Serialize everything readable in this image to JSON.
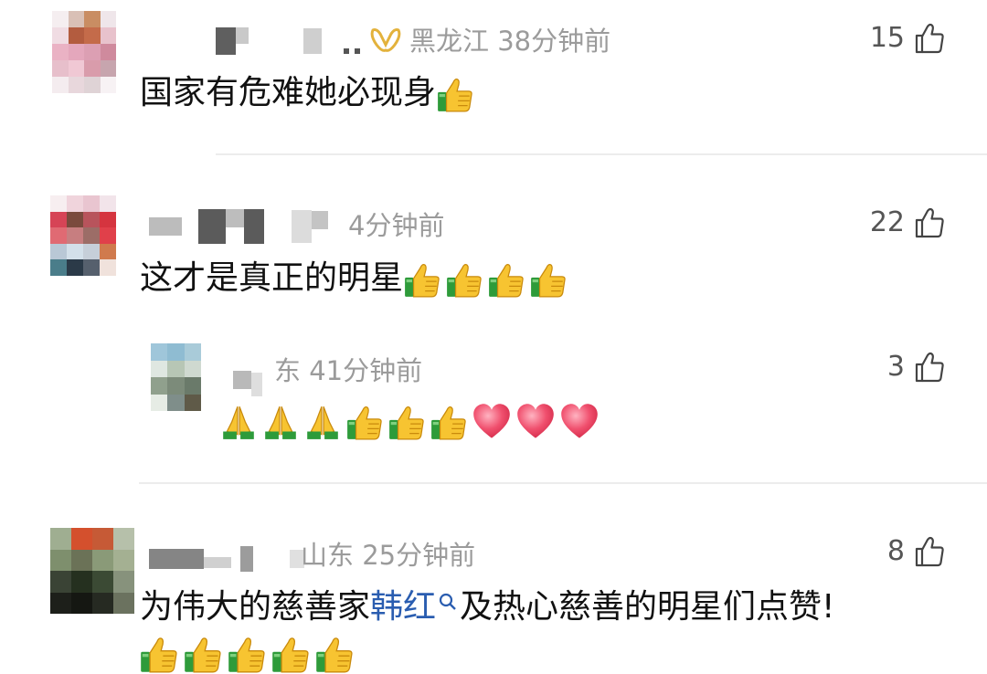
{
  "comments": [
    {
      "location": "黑龙江",
      "time": "38分钟前",
      "text": "国家有危难她必现身",
      "likes": "15",
      "emojis": [
        "thumbs-up"
      ]
    },
    {
      "location": "",
      "time": "4分钟前",
      "text": "这才是真正的明星",
      "likes": "22",
      "emojis": [
        "thumbs-up",
        "thumbs-up",
        "thumbs-up",
        "thumbs-up"
      ],
      "reply": {
        "location": "东",
        "time": "41分钟前",
        "likes": "3",
        "emojis": [
          "folded-hands",
          "folded-hands",
          "folded-hands",
          "thumbs-up",
          "thumbs-up",
          "thumbs-up",
          "red-heart",
          "red-heart",
          "red-heart"
        ]
      }
    },
    {
      "location": "山东",
      "time": "25分钟前",
      "text_before": "为伟大的慈善家",
      "link_text": "韩红",
      "text_after": "及热心慈善的明星们点赞!",
      "likes": "8",
      "emojis": [
        "thumbs-up",
        "thumbs-up",
        "thumbs-up",
        "thumbs-up",
        "thumbs-up"
      ]
    }
  ],
  "colors": {
    "meta": "#9b9b9b",
    "link": "#2a5db0",
    "divider": "#ececec",
    "medal": "#e3b23c"
  }
}
